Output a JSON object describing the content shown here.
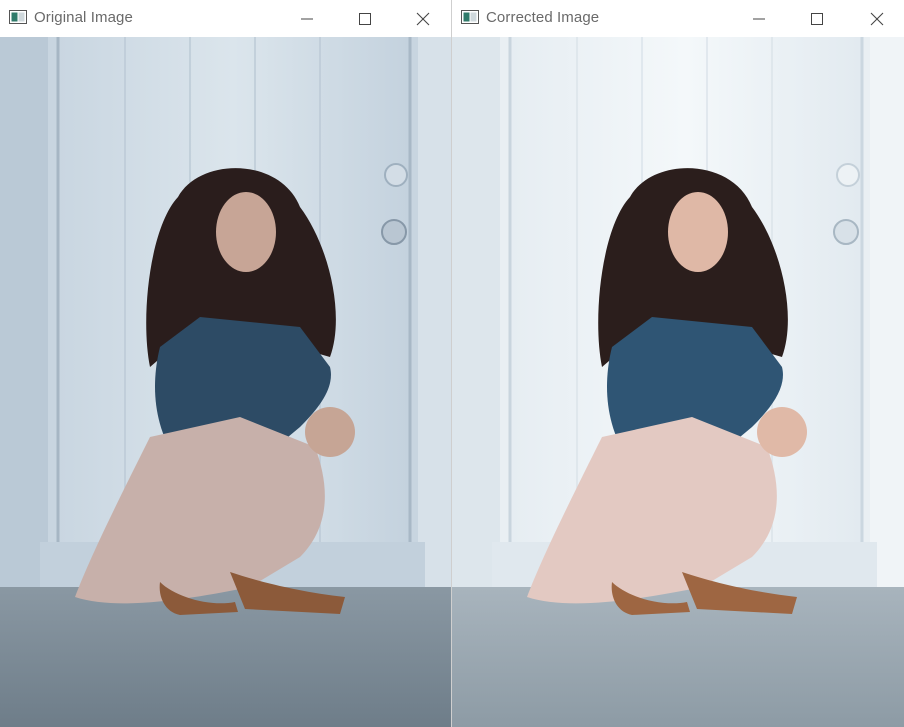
{
  "windows": [
    {
      "title": "Original Image",
      "icons": {
        "app": "image-window-icon",
        "minimize": "minimize-icon",
        "maximize": "maximize-icon",
        "close": "close-icon"
      },
      "photo": "woman-crouching-by-white-door",
      "colors": {
        "wall": "#c9d6e1",
        "wallShadow": "#a9b9c8",
        "door": "#d5e0e9",
        "ground": "#7b8a96",
        "dress": "#c7b0ac",
        "jacket": "#2b4a63"
      }
    },
    {
      "title": "Corrected Image",
      "icons": {
        "app": "image-window-icon",
        "minimize": "minimize-icon",
        "maximize": "maximize-icon",
        "close": "close-icon"
      },
      "photo": "woman-crouching-by-white-door-corrected",
      "colors": {
        "wall": "#e8eef2",
        "wallShadow": "#cfdbe3",
        "door": "#eff4f7",
        "ground": "#9aa7b0",
        "dress": "#e2c8c2",
        "jacket": "#2e5472"
      }
    }
  ]
}
